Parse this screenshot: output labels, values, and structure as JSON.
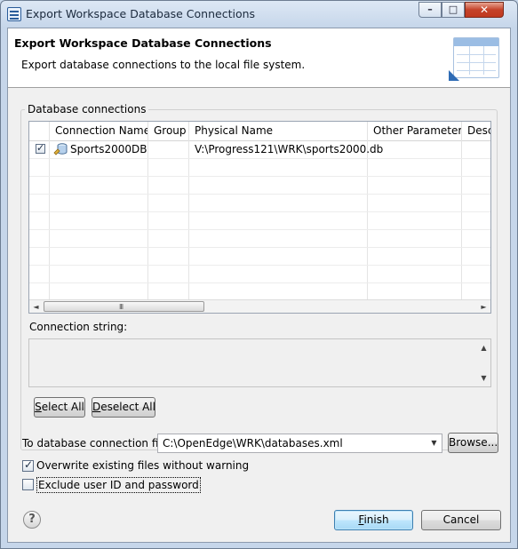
{
  "window": {
    "title": "Export Workspace Database Connections",
    "minimize_glyph": "–",
    "maximize_glyph": "□",
    "close_glyph": "✕"
  },
  "header": {
    "title": "Export Workspace Database Connections",
    "description": "Export database connections to the local file system."
  },
  "connections_group": {
    "label": "Database connections",
    "columns": [
      "Connection Name",
      "Group",
      "Physical Name",
      "Other Parameters",
      "Description"
    ],
    "rows": [
      {
        "checked": true,
        "connection_name": "Sports2000DB",
        "group": "",
        "physical_name": "V:\\Progress121\\WRK\\sports2000.db",
        "other_parameters": "",
        "description": ""
      }
    ],
    "scroll_left_glyph": "◄",
    "scroll_right_glyph": "►",
    "scroll_grip_glyph": "III",
    "connection_string_label": "Connection string:",
    "connection_string_value": "",
    "scroll_up_glyph": "▲",
    "scroll_down_glyph": "▼",
    "select_all_label": "Select All",
    "deselect_all_label": "Deselect All"
  },
  "target": {
    "label": "To database connection file:",
    "value": "C:\\OpenEdge\\WRK\\databases.xml",
    "dropdown_glyph": "▼",
    "browse_label": "Browse..."
  },
  "options": {
    "overwrite": {
      "label": "Overwrite existing files without warning",
      "checked": true
    },
    "exclude_credentials": {
      "label": "Exclude user ID and password",
      "checked": false
    }
  },
  "footer": {
    "help_glyph": "?",
    "finish_label": "Finish",
    "cancel_label": "Cancel"
  }
}
